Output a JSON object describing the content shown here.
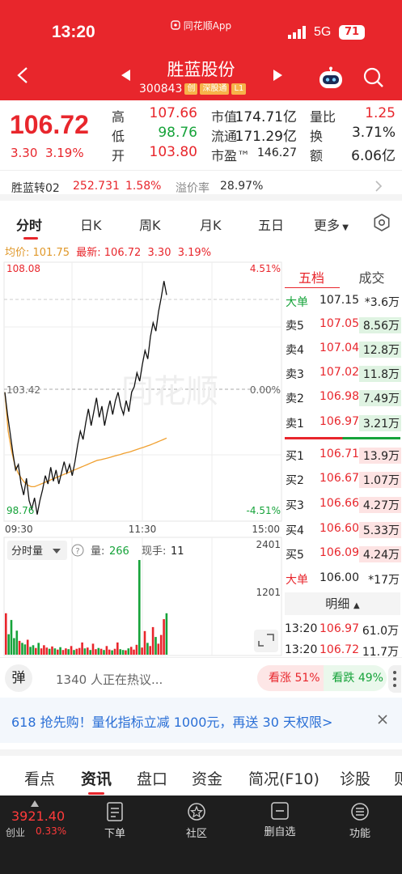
{
  "status_bar": {
    "time": "13:20",
    "app_label": "同花顺App",
    "network": "5G",
    "battery": "71"
  },
  "header": {
    "title": "胜蓝股份",
    "code": "300843",
    "tags": [
      "创",
      "深股通",
      "L1"
    ]
  },
  "quote": {
    "price": "106.72",
    "change": "3.30",
    "change_pct": "3.19%",
    "stats": [
      {
        "label": "高",
        "value": "107.66",
        "color": "red"
      },
      {
        "label": "低",
        "value": "98.76",
        "color": "green"
      },
      {
        "label": "开",
        "value": "103.80",
        "color": "red"
      },
      {
        "label": "市值",
        "value": "174.71亿",
        "color": "dark"
      },
      {
        "label": "流通",
        "value": "171.29亿",
        "color": "dark"
      },
      {
        "label": "市盈™",
        "value": "146.27",
        "color": "dark"
      },
      {
        "label": "量比",
        "value": "1.25",
        "color": "red"
      },
      {
        "label": "换",
        "value": "3.71%",
        "color": "dark"
      },
      {
        "label": "额",
        "value": "6.06亿",
        "color": "dark"
      }
    ]
  },
  "convertible": {
    "name": "胜蓝转02",
    "price": "252.731",
    "pct": "1.58%",
    "premium_label": "溢价率",
    "premium": "28.97%"
  },
  "tabs": [
    "分时",
    "日K",
    "周K",
    "月K",
    "五日",
    "更多"
  ],
  "avg_line": {
    "avg_label": "均价: 101.75",
    "latest_label": "最新: 106.72",
    "chg": "3.30",
    "pct": "3.19%"
  },
  "chart": {
    "y_max": "108.08",
    "y_mid": "103.42",
    "y_min": "98.76",
    "pct_max": "4.51%",
    "pct_mid": "0.00%",
    "pct_min": "-4.51%",
    "x_labels": [
      "09:30",
      "11:30",
      "15:00"
    ],
    "watermark": "同花顺",
    "vol_label": "分时量",
    "vol_value_label": "量:",
    "vol_value": "266",
    "hand_label": "现手:",
    "hand_value": "11",
    "vol_max": "2401",
    "vol_mid": "1201"
  },
  "chart_data": {
    "type": "line",
    "price_domain": [
      98.76,
      108.08
    ],
    "prev_close": 103.42,
    "price": [
      103.4,
      102.6,
      101.9,
      101.2,
      100.6,
      100.8,
      100.1,
      99.7,
      100.3,
      99.5,
      99.2,
      99.6,
      99.0,
      99.5,
      99.9,
      100.4,
      100.1,
      100.7,
      100.2,
      100.6,
      100.1,
      100.5,
      100.9,
      100.5,
      100.8,
      100.4,
      100.9,
      101.5,
      102.0,
      101.7,
      102.3,
      102.8,
      102.2,
      102.7,
      103.2,
      102.5,
      102.9,
      102.2,
      102.7,
      103.1,
      102.6,
      103.1,
      103.4,
      102.9,
      102.6,
      103.1,
      102.7,
      103.4,
      103.6,
      104.1,
      103.8,
      104.4,
      104.9,
      104.6,
      105.4,
      105.9,
      105.6,
      106.3,
      106.8,
      107.4,
      106.9
    ],
    "avg": [
      103.4,
      102.0,
      101.3,
      100.8,
      100.5,
      100.3,
      100.15,
      100.05,
      100.0,
      100.0,
      100.05,
      100.1,
      100.15,
      100.2,
      100.25,
      100.3,
      100.35,
      100.4,
      100.45,
      100.5,
      100.55,
      100.6,
      100.65,
      100.7,
      100.75,
      100.8,
      100.85,
      100.9,
      100.95,
      100.97,
      101.0,
      101.03,
      101.06,
      101.1,
      101.13,
      101.16,
      101.2,
      101.23,
      101.26,
      101.3,
      101.34,
      101.38,
      101.42,
      101.46,
      101.5,
      101.55,
      101.6,
      101.65,
      101.7,
      101.75
    ],
    "volume_domain": [
      0,
      2401
    ],
    "volume": [
      1050,
      520,
      880,
      420,
      610,
      350,
      300,
      260,
      380,
      200,
      240,
      170,
      300,
      160,
      240,
      180,
      150,
      210,
      160,
      130,
      190,
      120,
      160,
      140,
      220,
      120,
      150,
      170,
      310,
      160,
      180,
      120,
      280,
      140,
      170,
      150,
      120,
      220,
      130,
      110,
      150,
      310,
      140,
      120,
      110,
      160,
      200,
      130,
      250,
      2401,
      180,
      600,
      300,
      220,
      700,
      450,
      280,
      500,
      900,
      1050
    ]
  },
  "order_book": {
    "tab_active": "五档",
    "tab_other": "成交",
    "top": {
      "label": "大单",
      "price": "107.15",
      "vol": "*3.6万"
    },
    "asks": [
      {
        "label": "卖5",
        "price": "107.05",
        "vol": "8.56万"
      },
      {
        "label": "卖4",
        "price": "107.04",
        "vol": "12.8万"
      },
      {
        "label": "卖3",
        "price": "107.02",
        "vol": "11.8万"
      },
      {
        "label": "卖2",
        "price": "106.98",
        "vol": "7.49万"
      },
      {
        "label": "卖1",
        "price": "106.97",
        "vol": "3.21万"
      }
    ],
    "bids": [
      {
        "label": "买1",
        "price": "106.71",
        "vol": "13.9万"
      },
      {
        "label": "买2",
        "price": "106.67",
        "vol": "1.07万"
      },
      {
        "label": "买3",
        "price": "106.66",
        "vol": "4.27万"
      },
      {
        "label": "买4",
        "price": "106.60",
        "vol": "5.33万"
      },
      {
        "label": "买5",
        "price": "106.09",
        "vol": "4.24万"
      }
    ],
    "bottom": {
      "label": "大单",
      "price": "106.00",
      "vol": "*17万"
    },
    "detail_label": "明细",
    "ticks": [
      {
        "time": "13:20",
        "price": "106.97",
        "vol": "61.0万"
      },
      {
        "time": "13:20",
        "price": "106.72",
        "vol": "11.7万"
      }
    ]
  },
  "hot": {
    "barrage": "弹",
    "text": "1340 人正在热议...",
    "up": "看涨 51%",
    "down": "看跌 49%",
    "up_ratio": 0.51
  },
  "promo": {
    "text": "618 抢先购！量化指标立减 1000元，再送 30 天权限>"
  },
  "news_tabs": [
    "看点",
    "资讯",
    "盘口",
    "资金",
    "简况(F10)",
    "诊股",
    "则"
  ],
  "bottom_bar": {
    "index_value": "3921.40",
    "index_name": "创业",
    "index_pct": "0.33%",
    "items": [
      "下单",
      "社区",
      "删自选",
      "功能"
    ]
  },
  "colors": {
    "brand": "#e8262c",
    "down": "#16a33a",
    "avg_line": "#f0a030"
  }
}
